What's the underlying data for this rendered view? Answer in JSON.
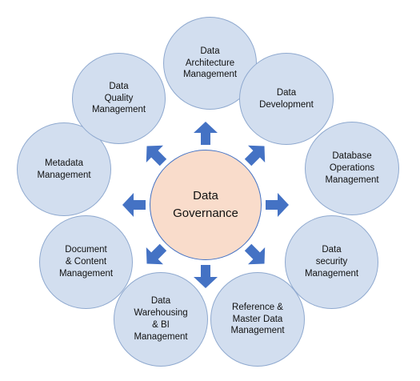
{
  "colors": {
    "node_fill": "#d2deef",
    "node_border": "#8fa9cf",
    "center_fill": "#f9dccb",
    "center_border": "#4472c4",
    "arrow_fill": "#4472c4"
  },
  "center": {
    "label": "Data\nGovernance"
  },
  "nodes": [
    {
      "label": "Data\nArchitecture\nManagement"
    },
    {
      "label": "Data\nDevelopment"
    },
    {
      "label": "Database\nOperations\nManagement"
    },
    {
      "label": "Data\nsecurity\nManagement"
    },
    {
      "label": "Reference &\nMaster Data\nManagement"
    },
    {
      "label": "Data\nWarehousing\n& BI\nManagement"
    },
    {
      "label": "Document\n& Content\nManagement"
    },
    {
      "label": "Metadata\nManagement"
    },
    {
      "label": "Data\nQuality\nManagement"
    }
  ],
  "arrows": {
    "count": 8,
    "direction": "outward",
    "icon": "block-arrow-icon"
  }
}
